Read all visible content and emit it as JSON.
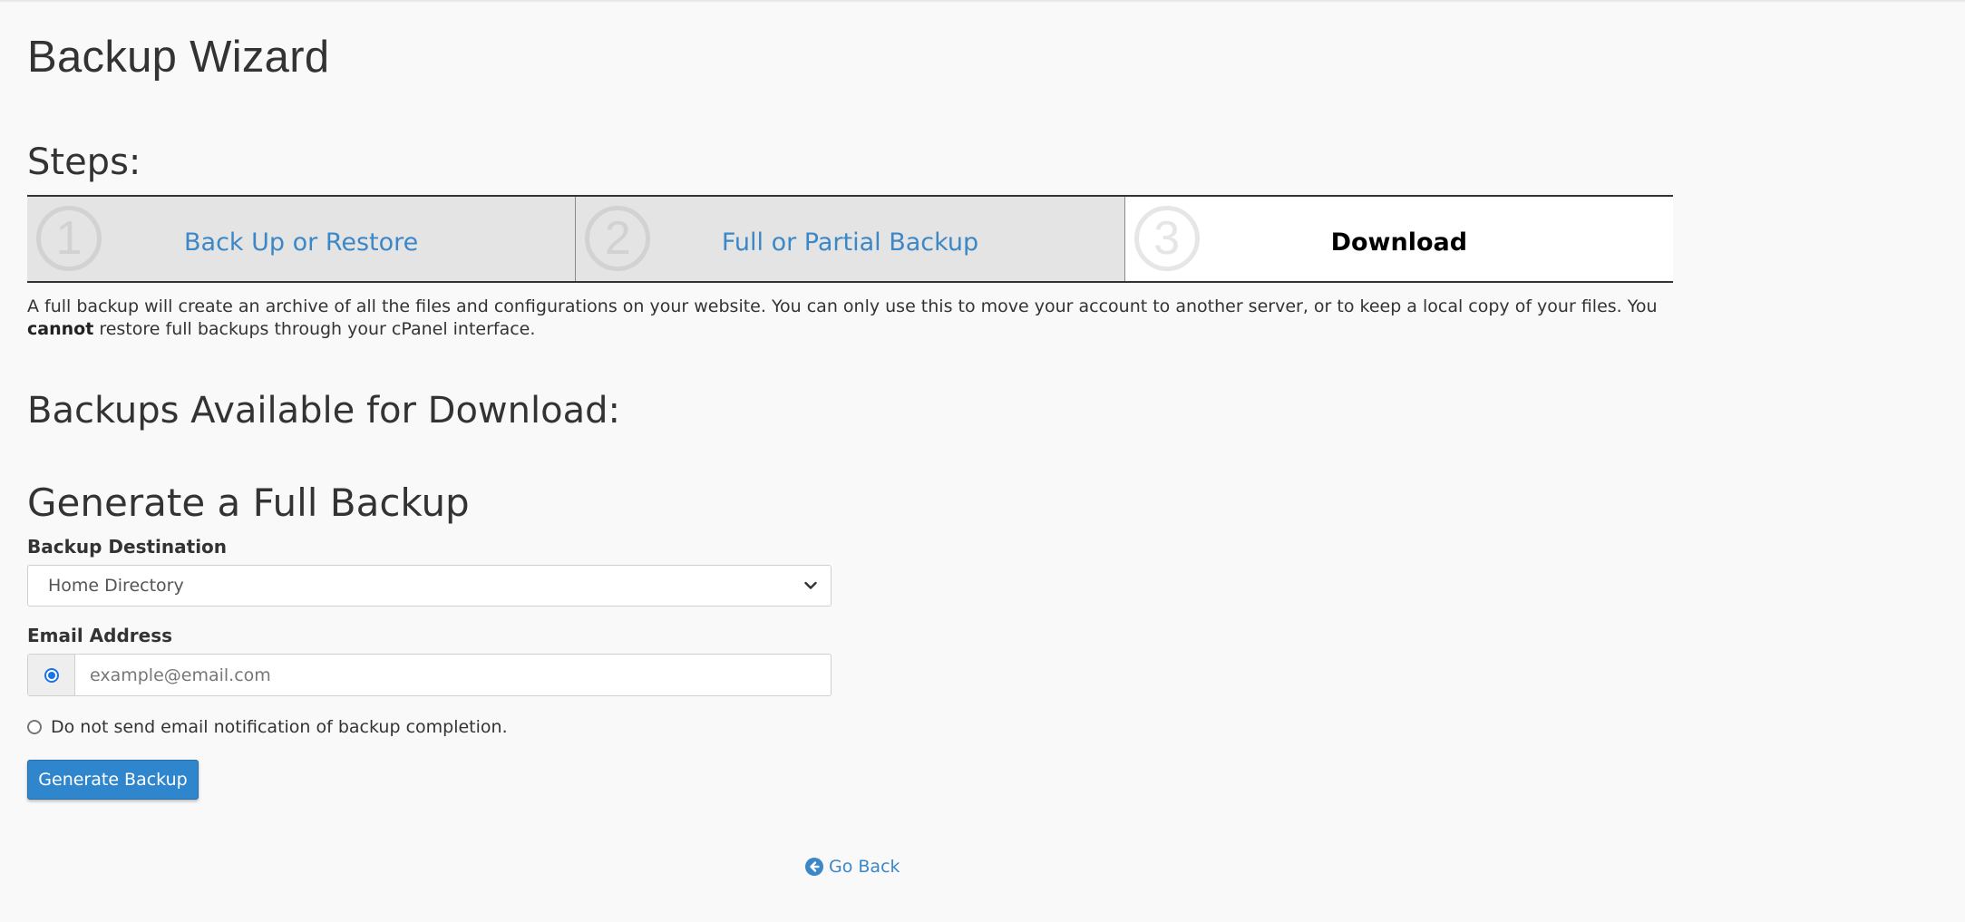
{
  "page": {
    "title": "Backup Wizard"
  },
  "steps": {
    "heading": "Steps:",
    "items": [
      {
        "number": "1",
        "label": "Back Up or Restore",
        "active": false
      },
      {
        "number": "2",
        "label": "Full or Partial Backup",
        "active": false
      },
      {
        "number": "3",
        "label": "Download",
        "active": true
      }
    ]
  },
  "description": {
    "text_before": "A full backup will create an archive of all the files and configurations on your website. You can only use this to move your account to another server, or to keep a local copy of your files. You ",
    "emphasis": "cannot",
    "text_after": " restore full backups through your cPanel interface."
  },
  "available": {
    "heading": "Backups Available for Download:"
  },
  "generate": {
    "heading": "Generate a Full Backup",
    "destination_label": "Backup Destination",
    "destination_value": "Home Directory",
    "email_label": "Email Address",
    "email_placeholder": "example@email.com",
    "no_email_label": "Do not send email notification of backup completion.",
    "button_label": "Generate Backup"
  },
  "footer": {
    "go_back_label": "Go Back"
  },
  "colors": {
    "link": "#3b87c7",
    "primary_button": "#2f86cc",
    "step_inactive_bg": "#e4e4e4",
    "step_active_bg": "#ffffff"
  },
  "icons": {
    "select_caret": "chevron-down-icon",
    "go_back": "arrow-circle-left-icon"
  }
}
